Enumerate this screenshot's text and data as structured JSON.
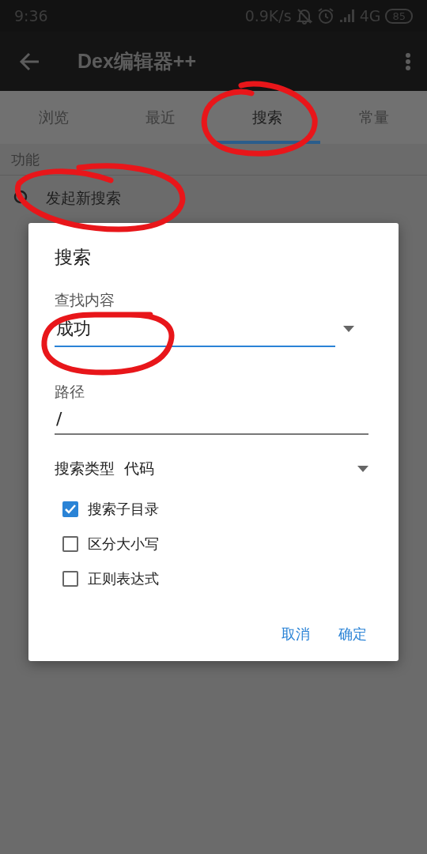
{
  "status_bar": {
    "time": "9:36",
    "net_speed": "0.9K/s",
    "network": "4G",
    "battery": "85"
  },
  "app_bar": {
    "title": "Dex编辑器++"
  },
  "tabs": [
    {
      "label": "浏览",
      "selected": false
    },
    {
      "label": "最近",
      "selected": false
    },
    {
      "label": "搜索",
      "selected": true
    },
    {
      "label": "常量",
      "selected": false
    }
  ],
  "section": {
    "header": "功能",
    "items": [
      {
        "label": "发起新搜索"
      }
    ]
  },
  "dialog": {
    "title": "搜索",
    "query": {
      "label": "查找内容",
      "value": "成功",
      "focused": true
    },
    "path": {
      "label": "路径",
      "value": "/",
      "focused": false
    },
    "search_type": {
      "label": "搜索类型",
      "value": "代码"
    },
    "options": [
      {
        "label": "搜索子目录",
        "checked": true
      },
      {
        "label": "区分大小写",
        "checked": false
      },
      {
        "label": "正则表达式",
        "checked": false
      }
    ],
    "buttons": [
      "取消",
      "确定"
    ]
  }
}
